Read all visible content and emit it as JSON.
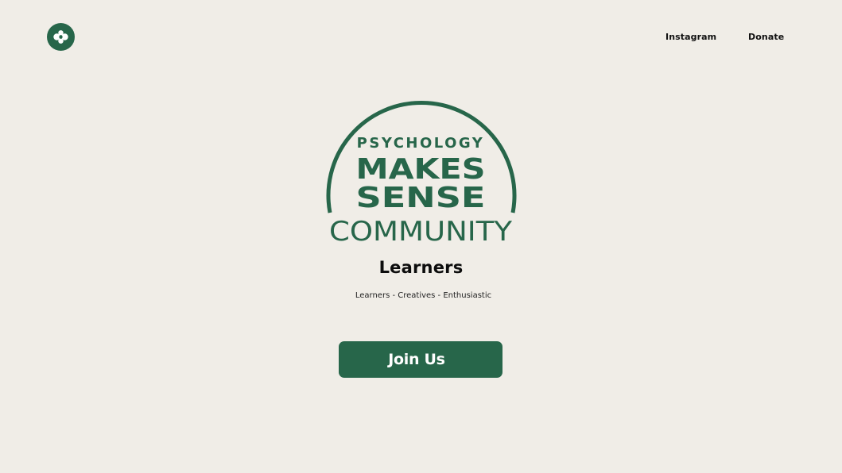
{
  "header": {
    "logo_icon": "clover-logo-icon",
    "nav": [
      {
        "label": "Instagram"
      },
      {
        "label": "Donate"
      }
    ]
  },
  "emblem": {
    "line1": "PSYCHOLOGY",
    "line2": "MAKES",
    "line3": "SENSE",
    "line4": "COMMUNITY"
  },
  "hero": {
    "title": "Learners",
    "subtitle": "Learners - Creatives - Enthusiastic",
    "cta_label": "Join Us"
  },
  "colors": {
    "brand_green": "#27664a",
    "background": "#f0ede7",
    "text": "#111111"
  }
}
